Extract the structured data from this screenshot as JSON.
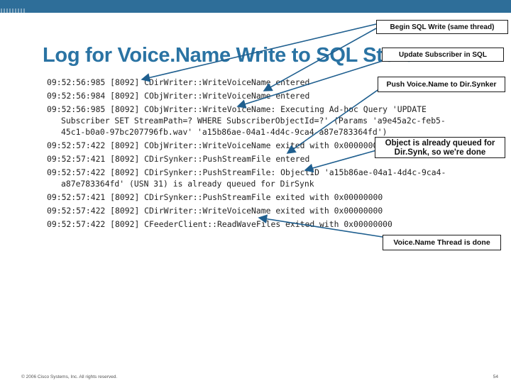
{
  "slide": {
    "title": "Log for Voice.Name Write to SQL Store",
    "footer": "© 2006 Cisco Systems, Inc. All rights reserved.",
    "page_number": "54"
  },
  "log_lines": [
    "09:52:56:985 [8092] CDirWriter::WriteVoiceName entered",
    "09:52:56:984 [8092] CObjWriter::WriteVoiceName entered",
    "09:52:56:985 [8092] CObjWriter::WriteVoiceName: Executing Ad-hoc Query 'UPDATE",
    "Subscriber SET StreamPath=? WHERE SubscriberObjectId=?' (Params 'a9e45a2c-feb5-",
    "45c1-b0a0-97bc207796fb.wav' 'a15b86ae-04a1-4d4c-9ca4-a87e783364fd')",
    "09:52:57:422 [8092] CObjWriter::WriteVoiceName exited with 0x00000000",
    "09:52:57:421 [8092] CDirSynker::PushStreamFile entered",
    "09:52:57:422 [8092] CDirSynker::PushStreamFile: ObjectID 'a15b86ae-04a1-4d4c-9ca4-",
    "a87e783364fd' (USN 31) is already queued for DirSynk",
    "09:52:57:421 [8092] CDirSynker::PushStreamFile exited with 0x00000000",
    "09:52:57:422 [8092] CDirWriter::WriteVoiceName exited with 0x00000000",
    "09:52:57:422 [8092] CFeederClient::ReadWaveFiles exited with 0x00000000"
  ],
  "callouts": {
    "begin_sql_write": "Begin SQL Write (same thread)",
    "update_subscriber": "Update Subscriber in SQL",
    "push_voicename": "Push Voice.Name to Dir.Synker",
    "already_queued_line1": "Object is already queued for",
    "already_queued_line2": "Dir.Synk, so we're done",
    "thread_done": "Voice.Name Thread is done"
  },
  "colors": {
    "top_bar": "#2e6e99",
    "title": "#2a73a3"
  }
}
